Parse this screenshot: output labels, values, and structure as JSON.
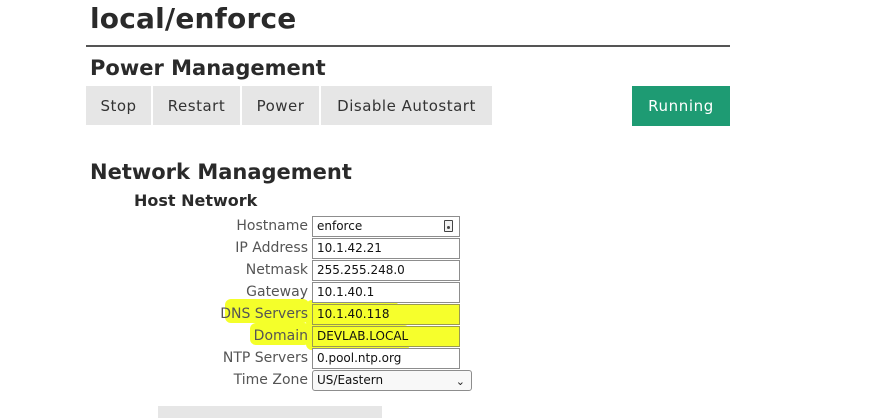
{
  "page": {
    "title": "local/enforce"
  },
  "power": {
    "heading": "Power Management",
    "buttons": [
      {
        "label": "Stop"
      },
      {
        "label": "Restart"
      },
      {
        "label": "Power"
      },
      {
        "label": "Disable Autostart"
      }
    ],
    "status_label": "Running",
    "status_color": "#1e9b73"
  },
  "network": {
    "heading": "Network Management",
    "subheading": "Host Network",
    "fields": {
      "hostname": {
        "label": "Hostname",
        "value": "enforce"
      },
      "ip": {
        "label": "IP Address",
        "value": "10.1.42.21"
      },
      "netmask": {
        "label": "Netmask",
        "value": "255.255.248.0"
      },
      "gateway": {
        "label": "Gateway",
        "value": "10.1.40.1"
      },
      "dns": {
        "label": "DNS Servers",
        "value": "10.1.40.118"
      },
      "domain": {
        "label": "Domain",
        "value": "DEVLAB.LOCAL"
      },
      "ntp": {
        "label": "NTP Servers",
        "value": "0.pool.ntp.org"
      },
      "timezone": {
        "label": "Time Zone",
        "value": "US/Eastern"
      }
    },
    "highlight_color": "#f4ff2a"
  }
}
